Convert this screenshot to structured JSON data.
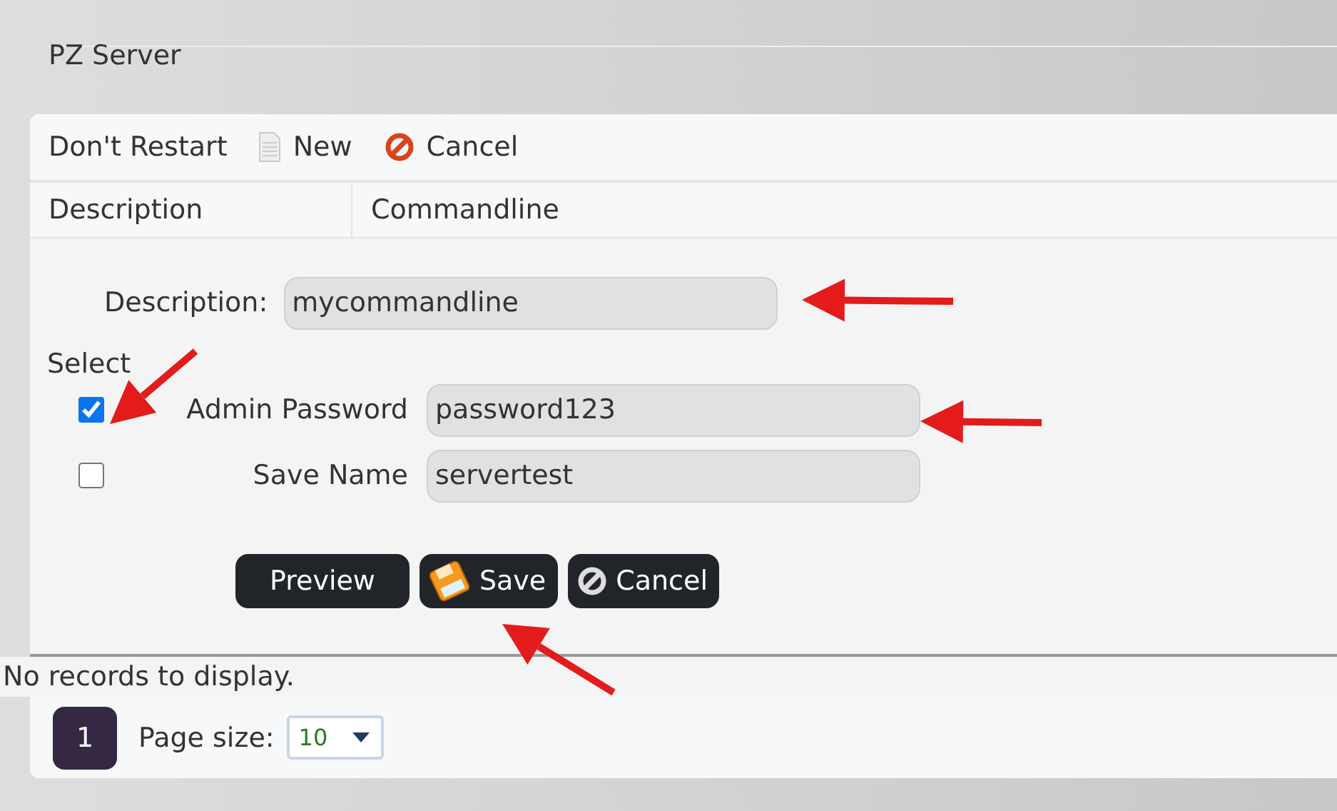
{
  "page_title": "PZ Server",
  "toolbar": [
    {
      "label": "Don't Restart",
      "kind": "text"
    },
    {
      "label": "New",
      "kind": "new"
    },
    {
      "label": "Cancel",
      "kind": "cancel"
    }
  ],
  "columns": [
    "Description",
    "Commandline"
  ],
  "form": {
    "description_label": "Description:",
    "description_value": "mycommandline",
    "select_label": "Select",
    "options": [
      {
        "label": "Admin Password",
        "value": "password123",
        "checked": true
      },
      {
        "label": "Save Name",
        "value": "servertest",
        "checked": false
      }
    ],
    "buttons": [
      {
        "label": "Preview",
        "kind": "plain"
      },
      {
        "label": "Save",
        "kind": "save"
      },
      {
        "label": "Cancel",
        "kind": "cancel"
      }
    ]
  },
  "empty_message": "No records to display.",
  "pager": {
    "pages": [
      {
        "label": "1",
        "selected": true
      }
    ],
    "page_size_label": "Page size:",
    "page_size": "10"
  }
}
